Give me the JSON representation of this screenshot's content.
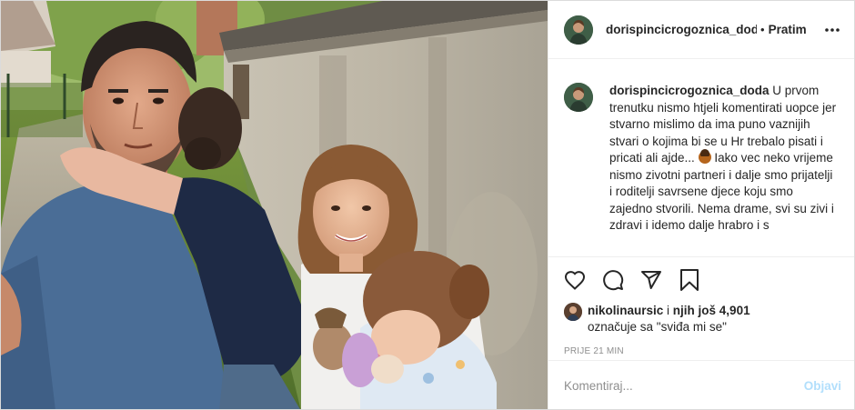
{
  "header": {
    "username": "dorispincicrogoznica_doda",
    "separator": "•",
    "follow_label": "Pratim"
  },
  "caption": {
    "username": "dorispincicrogoznica_doda",
    "text_before_emoji": "U prvom trenutku nismo htjeli komentirati uopce jer stvarno mislimo da ima puno vaznijih stvari o kojima bi se u Hr trebalo pisati i pricati ali ajde...",
    "emoji": "woman-shrugging-emoji",
    "text_after_emoji": " Iako vec neko vrijeme nismo zivotni partneri i dalje smo prijatelji i roditelji savrsene djece koju smo zajedno stvorili. Nema drame, svi su zivi i zdravi i idemo dalje hrabro i s"
  },
  "actions": {
    "like_icon": "heart-icon",
    "comment_icon": "comment-icon",
    "share_icon": "share-icon",
    "save_icon": "bookmark-icon"
  },
  "likes": {
    "user": "nikolinaursic",
    "connector": " i ",
    "others": "njih još 4,901",
    "line2": "označuje sa \"sviđa mi se\""
  },
  "timestamp": "PRIJE 21 MIN",
  "comment_box": {
    "placeholder": "Komentiraj...",
    "post_label": "Objavi"
  },
  "colors": {
    "text": "#262626",
    "muted": "#8e8e8e",
    "border": "#efefef",
    "post_button_disabled": "#b2dffc"
  }
}
